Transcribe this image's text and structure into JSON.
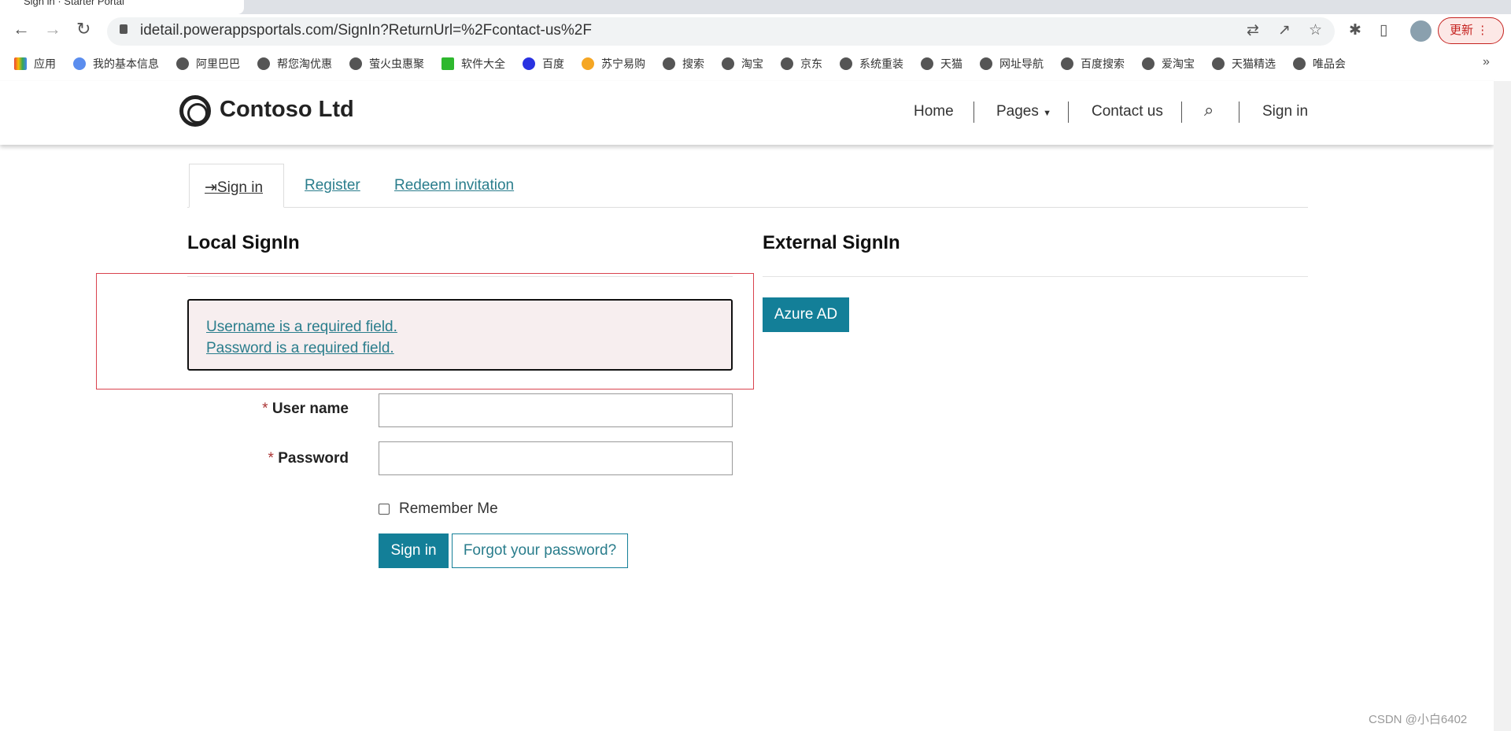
{
  "browser": {
    "tab_title": "Sign in · Starter Portal",
    "url": "idetail.powerappsportals.com/SignIn?ReturnUrl=%2Fcontact-us%2F",
    "update_label": "更新",
    "bookmarks": [
      "应用",
      "我的基本信息",
      "阿里巴巴",
      "帮您淘优惠",
      "萤火虫惠聚",
      "软件大全",
      "百度",
      "苏宁易购",
      "搜索",
      "淘宝",
      "京东",
      "系统重装",
      "天猫",
      "网址导航",
      "百度搜索",
      "爱淘宝",
      "天猫精选",
      "唯品会"
    ],
    "more": "»"
  },
  "header": {
    "brand": "Contoso Ltd",
    "nav": {
      "home": "Home",
      "pages": "Pages",
      "contact": "Contact us",
      "signin": "Sign in"
    }
  },
  "tabs": {
    "signin": "Sign in",
    "register": "Register",
    "redeem": "Redeem invitation"
  },
  "local": {
    "title": "Local SignIn",
    "errors": [
      "Username is a required field.",
      "Password is a required field."
    ],
    "username_label": "User name",
    "password_label": "Password",
    "required_mark": "*",
    "remember": "Remember Me",
    "signin_button": "Sign in",
    "forgot_button": "Forgot your password?"
  },
  "external": {
    "title": "External SignIn",
    "azure_button": "Azure AD"
  },
  "watermark": "CSDN @小白6402",
  "colors": {
    "accent": "#137f98",
    "link": "#2a7d8c",
    "error_bg": "#f7eeef",
    "highlight_outline": "#d9434e"
  }
}
